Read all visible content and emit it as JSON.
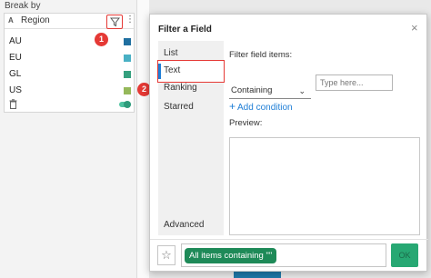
{
  "left_panel": {
    "break_by_label": "Break by",
    "field": {
      "type_icon": "A",
      "name": "Region",
      "rows": [
        {
          "label": "AU",
          "color": "#1f6fa0"
        },
        {
          "label": "EU",
          "color": "#49b0c4"
        },
        {
          "label": "GL",
          "color": "#35a07e"
        },
        {
          "label": "US",
          "color": "#95b85a"
        }
      ]
    }
  },
  "callouts": [
    "1",
    "2"
  ],
  "dialog": {
    "title": "Filter a Field",
    "close_icon": "×",
    "tabs": [
      {
        "label": "List"
      },
      {
        "label": "Text",
        "active": true
      },
      {
        "label": "Ranking"
      },
      {
        "label": "Starred"
      },
      {
        "label": "Advanced"
      }
    ],
    "filter_items_label": "Filter field items:",
    "mode_select_value": "Containing",
    "text_input_placeholder": "Type here...",
    "add_condition_label": "Add condition",
    "preview_label": "Preview:",
    "summary_pill": "All items containing \"\"",
    "ok_label": "OK"
  },
  "colors": {
    "accent": "#1f7ed6",
    "callout": "#e53935",
    "pill": "#1e8a58",
    "ok": "#27a873"
  }
}
